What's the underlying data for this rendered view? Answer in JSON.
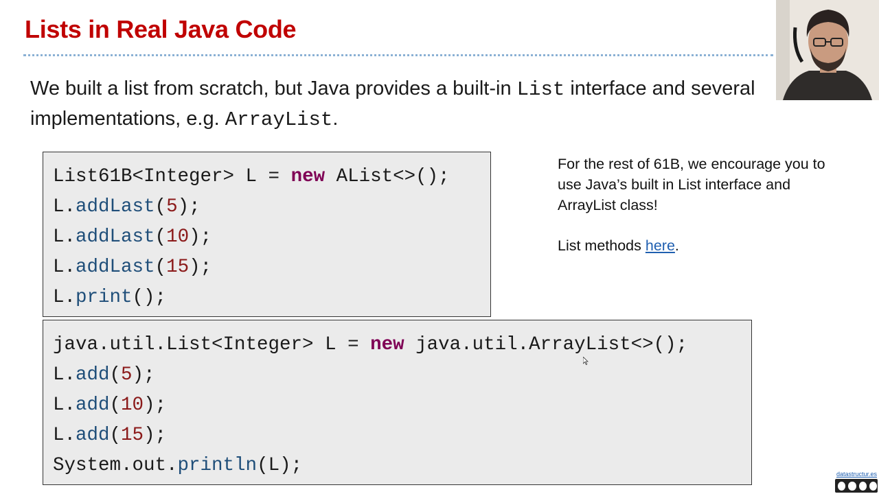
{
  "slide": {
    "title": "Lists in Real Java Code",
    "intro": {
      "part1": "We built a list from scratch, but Java provides a built-in ",
      "code1": "List",
      "part2": " interface and several implementations, e.g. ",
      "code2": "ArrayList",
      "part3": "."
    }
  },
  "code1": {
    "line1": {
      "a": "List61B<Integer> L = ",
      "kw": "new",
      "b": " AList<>();"
    },
    "line2": {
      "obj": "L.",
      "method": "addLast",
      "open": "(",
      "num": "5",
      "close": ");"
    },
    "line3": {
      "obj": "L.",
      "method": "addLast",
      "open": "(",
      "num": "10",
      "close": ");"
    },
    "line4": {
      "obj": "L.",
      "method": "addLast",
      "open": "(",
      "num": "15",
      "close": ");"
    },
    "line5": {
      "obj": "L.",
      "method": "print",
      "close": "();"
    }
  },
  "code2": {
    "line1": {
      "a": "java.util.List<Integer> L = ",
      "kw": "new",
      "b": " java.util.ArrayList<>();"
    },
    "line2": {
      "obj": "L.",
      "method": "add",
      "open": "(",
      "num": "5",
      "close": ");"
    },
    "line3": {
      "obj": "L.",
      "method": "add",
      "open": "(",
      "num": "10",
      "close": ");"
    },
    "line4": {
      "obj": "L.",
      "method": "add",
      "open": "(",
      "num": "15",
      "close": ");"
    },
    "line5": {
      "obj": "System.out.",
      "method": "println",
      "close": "(L);"
    }
  },
  "note": {
    "paragraph1": "For the rest of 61B, we encourage you to use Java’s built in List interface and ArrayList class!",
    "methods_prefix": "List methods ",
    "methods_link": "here",
    "methods_suffix": "."
  },
  "footer": {
    "site_link": "datastructur.es",
    "license_icon": "cc-by-nc-sa-icon"
  },
  "colors": {
    "title": "#c00000",
    "keyword": "#7f0055",
    "method": "#1f4e79",
    "number": "#8b1a1a",
    "link": "#1f5fb0"
  }
}
